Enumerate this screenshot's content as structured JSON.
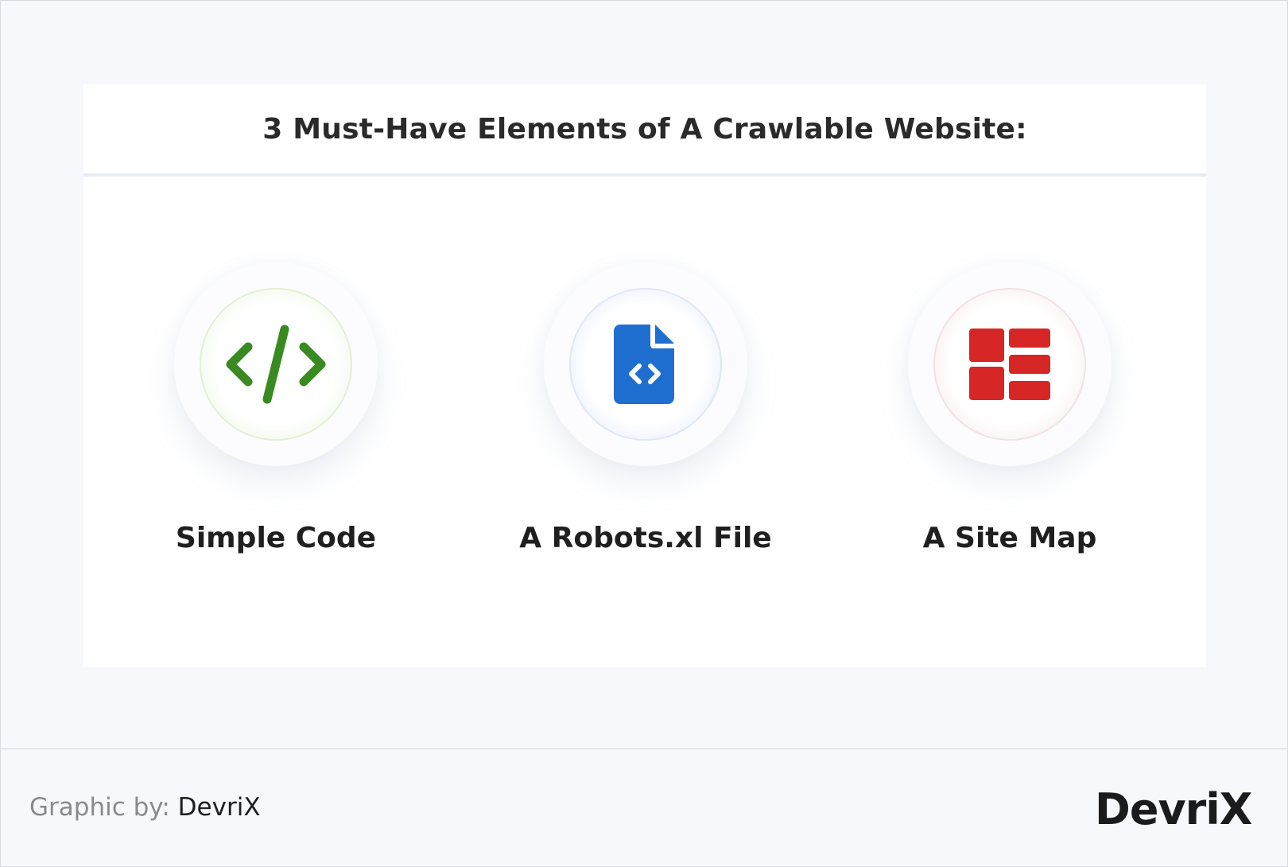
{
  "title": "3 Must-Have Elements of A Crawlable Website:",
  "items": [
    {
      "label": "Simple Code",
      "icon": "code-icon",
      "accent": "#3a8a22"
    },
    {
      "label": "A Robots.xl File",
      "icon": "code-file-icon",
      "accent": "#1f6fd0"
    },
    {
      "label": "A Site Map",
      "icon": "site-map-icon",
      "accent": "#d62626"
    }
  ],
  "footer": {
    "credit_prefix": "Graphic by:",
    "credit_brand": "DevriX",
    "logo_text": "DevriX",
    "logo_x_color": "#58c130"
  }
}
